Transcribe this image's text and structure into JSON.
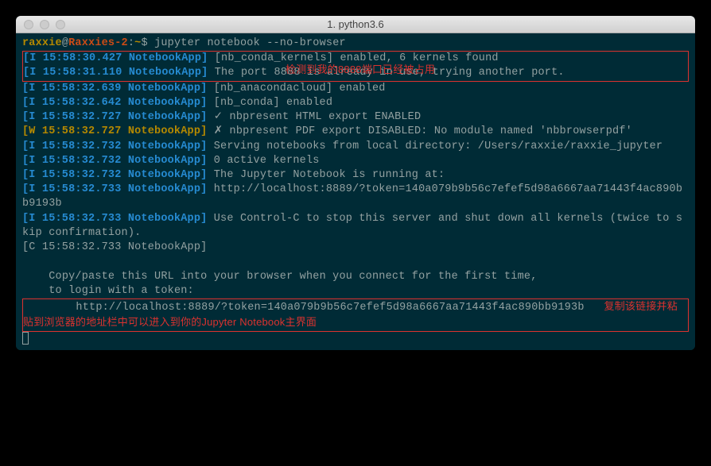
{
  "window": {
    "title": "1. python3.6"
  },
  "prompt": {
    "user": "raxxie",
    "at": "@",
    "host": "Raxxies-2",
    "sep": ":",
    "path": "~",
    "dollar": "$ ",
    "command": "jupyter notebook --no-browser"
  },
  "annotations": {
    "port_busy": "检测到我的8888端口已经被占用",
    "copy_url": "复制该链接并粘贴到浏览器的地址栏中可以进入到你的Jupyter Notebook主界面"
  },
  "lines": {
    "l1_tag": "[I 15:58:30.427 NotebookApp]",
    "l1_msg": " [nb_conda_kernels] enabled, 6 kernels found",
    "l2_tag": "[I 15:58:31.110 NotebookApp]",
    "l2_msg": " The port 8888 is already in use, trying another port.",
    "l3_tag": "[I 15:58:32.639 NotebookApp]",
    "l3_msg": " [nb_anacondacloud] enabled",
    "l4_tag": "[I 15:58:32.642 NotebookApp]",
    "l4_msg": " [nb_conda] enabled",
    "l5_tag": "[I 15:58:32.727 NotebookApp]",
    "l5_msg": " ✓ nbpresent HTML export ENABLED",
    "l6_tag": "[W 15:58:32.727 NotebookApp]",
    "l6_msg": " ✗ nbpresent PDF export DISABLED: No module named 'nbbrowserpdf'",
    "l7_tag": "[I 15:58:32.732 NotebookApp]",
    "l7_msg": " Serving notebooks from local directory: /Users/raxxie/raxxie_jupyter",
    "l8_tag": "[I 15:58:32.732 NotebookApp]",
    "l8_msg": " 0 active kernels",
    "l9_tag": "[I 15:58:32.732 NotebookApp]",
    "l9_msg": " The Jupyter Notebook is running at:",
    "l10_tag": "[I 15:58:32.733 NotebookApp]",
    "l10_msg": " http://localhost:8889/?token=140a079b9b56c7efef5d98a6667aa71443f4ac890bb9193b",
    "l11_tag": "[I 15:58:32.733 NotebookApp]",
    "l11_msg": " Use Control-C to stop this server and shut down all kernels (twice to skip confirmation).",
    "l12_tag": "[C 15:58:32.733 NotebookApp]",
    "blank": "",
    "copy1": "    Copy/paste this URL into your browser when you connect for the first time,",
    "copy2": "    to login with a token:",
    "url": "        http://localhost:8889/?token=140a079b9b56c7efef5d98a6667aa71443f4ac890bb9193b"
  }
}
